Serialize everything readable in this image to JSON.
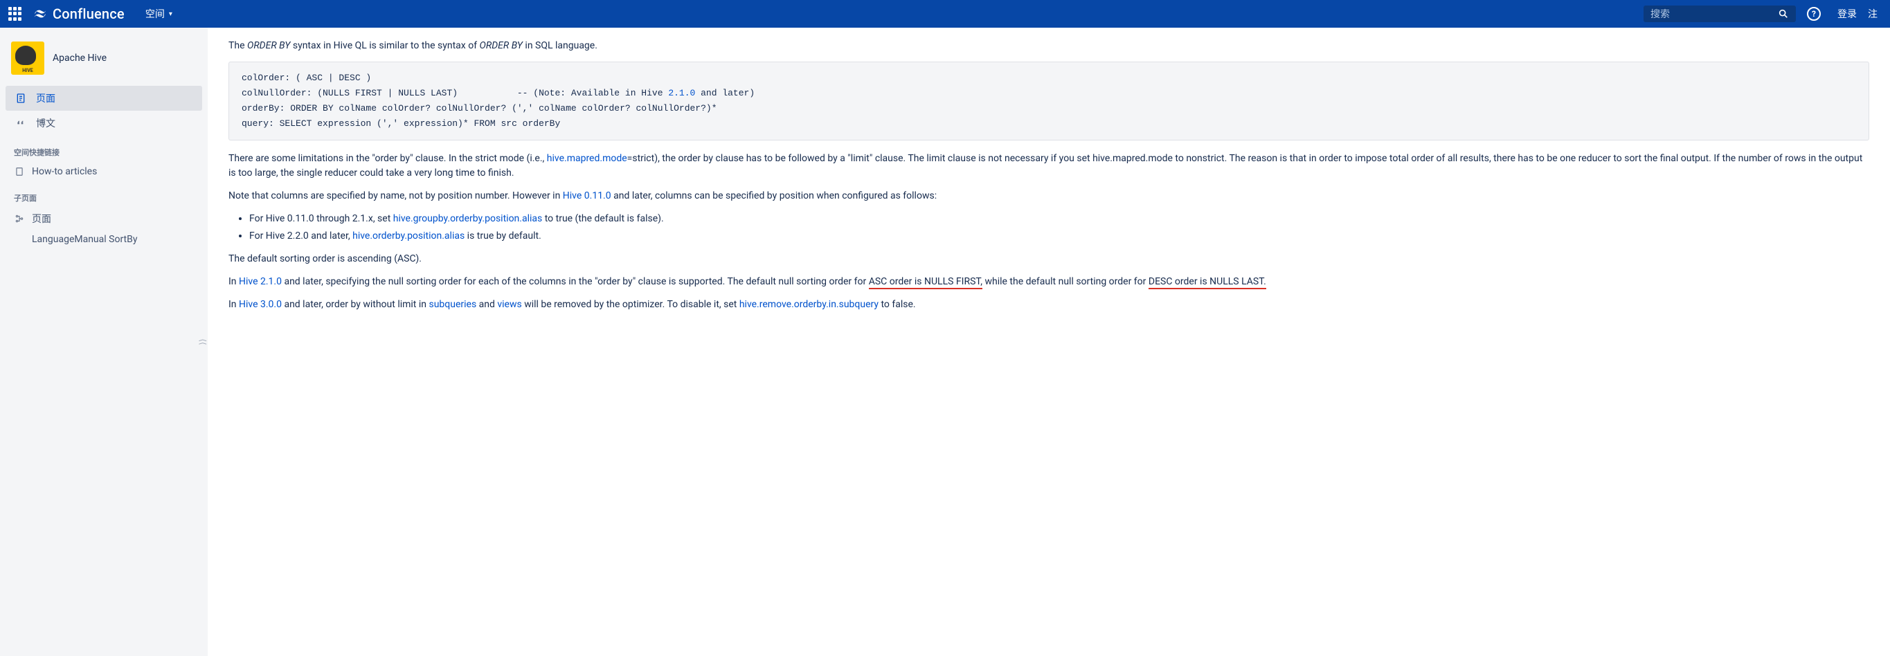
{
  "header": {
    "logo_text": "Confluence",
    "nav_spaces": "空间",
    "search_placeholder": "搜索",
    "login": "登录",
    "register": "注"
  },
  "sidebar": {
    "space_name": "Apache Hive",
    "nav": {
      "pages": "页面",
      "blog": "博文"
    },
    "section_shortcuts": "空间快捷链接",
    "shortcut_howto": "How-to articles",
    "section_children": "子页面",
    "tree_pages": "页面",
    "tree_child": "LanguageManual SortBy"
  },
  "content": {
    "p1_pre": "The ",
    "p1_orderby1": "ORDER BY",
    "p1_mid": " syntax in Hive QL is similar to the syntax of ",
    "p1_orderby2": "ORDER BY",
    "p1_post": " in SQL language.",
    "code_l1": "colOrder: ( ASC | DESC )",
    "code_l2a": "colNullOrder: (NULLS FIRST | NULLS LAST)           -- (Note: Available in Hive ",
    "code_l2_ver": "2.1.0",
    "code_l2b": " and later)",
    "code_l3": "orderBy: ORDER BY colName colOrder? colNullOrder? (',' colName colOrder? colNullOrder?)*",
    "code_l4": "query: SELECT expression (',' expression)* FROM src orderBy",
    "p2_pre": "There are some limitations in the \"order by\" clause. In the strict mode (i.e., ",
    "p2_link": "hive.mapred.mode",
    "p2_post": "=strict), the order by clause has to be followed by a \"limit\" clause. The limit clause is not necessary if you set hive.mapred.mode to nonstrict. The reason is that in order to impose total order of all results, there has to be one reducer to sort the final output. If the number of rows in the output is too large, the single reducer could take a very long time to finish.",
    "p3_pre": "Note that columns are specified by name, not by position number. However in ",
    "p3_link": "Hive 0.11.0",
    "p3_post": " and later, columns can be specified by position when configured as follows:",
    "li1_pre": "For Hive 0.11.0 through 2.1.x, set ",
    "li1_link": "hive.groupby.orderby.position.alias",
    "li1_post": " to true (the default is false).",
    "li2_pre": "For Hive 2.2.0 and later, ",
    "li2_link": "hive.orderby.position.alias",
    "li2_post": " is true by default.",
    "p4": "The default sorting order is ascending (ASC).",
    "p5_pre": "In ",
    "p5_link": "Hive 2.1.0",
    "p5_mid": " and later, specifying the null sorting order for each of the columns in the \"order by\" clause is supported. The default null sorting order for ",
    "p5_u1": "ASC order is NULLS FIRST,",
    "p5_mid2": " while the default null sorting order for ",
    "p5_u2": "DESC order is NULLS LAST.",
    "p6_pre": "In ",
    "p6_link1": "Hive 3.0.0",
    "p6_mid1": " and later, order by without limit in ",
    "p6_link2": "subqueries",
    "p6_mid2": " and ",
    "p6_link3": "views",
    "p6_mid3": " will be removed by the optimizer. To disable it, set ",
    "p6_link4": "hive.remove.orderby.in.subquery",
    "p6_post": " to false."
  }
}
